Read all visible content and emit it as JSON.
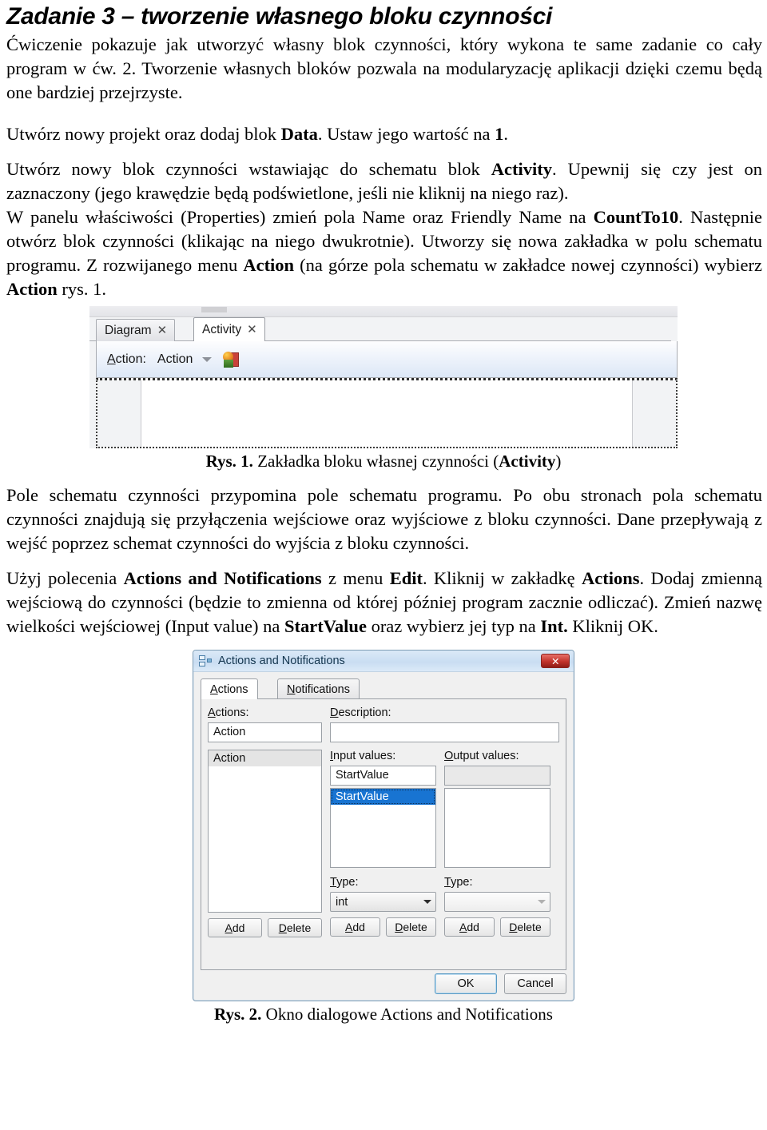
{
  "document": {
    "title": "Zadanie 3 – tworzenie własnego bloku czynności",
    "paragraphs": {
      "p1_a": "Ćwiczenie pokazuje jak utworzyć własny blok czynności, który wykona te same zadanie co cały program w ćw. 2. Tworzenie własnych bloków pozwala na modularyzację aplikacji dzięki czemu będą one bardziej przejrzyste.",
      "p2_pre": "Utwórz nowy projekt oraz dodaj blok ",
      "p2_b1": "Data",
      "p2_post": ". Ustaw jego wartość na ",
      "p2_b2": "1",
      "p2_end": ".",
      "p3_s1": "Utwórz nowy blok czynności wstawiając do schematu blok ",
      "p3_b1": "Activity",
      "p3_s2": ". Upewnij się czy jest on zaznaczony (jego krawędzie będą podświetlone, jeśli nie kliknij na niego raz).",
      "p4_s1": "W panelu właściwości (Properties) zmień pola Name oraz Friendly Name na ",
      "p4_b1": "CountTo10",
      "p4_s2": ". Następnie otwórz blok czynności (klikając na niego dwukrotnie). Utworzy się nowa zakładka w polu schematu programu. Z rozwijanego menu ",
      "p4_b2": "Action",
      "p4_s3": " (na górze pola schematu w zakładce nowej czynności) wybierz ",
      "p4_b3": "Action",
      "p4_s4": " rys. 1.",
      "p5": "Pole schematu czynności przypomina pole schematu programu. Po obu stronach pola schematu czynności znajdują się przyłączenia wejściowe oraz wyjściowe z bloku czynności. Dane przepływają z wejść poprzez schemat czynności do wyjścia z bloku czynności.",
      "p6_s1": "Użyj polecenia ",
      "p6_b1": "Actions and Notifications",
      "p6_s2": " z menu ",
      "p6_b2": "Edit",
      "p6_s3": ". Kliknij w zakładkę ",
      "p6_b3": "Actions",
      "p6_s4": ". Dodaj zmienną wejściową do czynności (będzie to zmienna od której później program zacznie odliczać). Zmień nazwę wielkości wejściowej (Input value) na  ",
      "p6_b4": "StartValue",
      "p6_s5": " oraz wybierz jej typ na ",
      "p6_b5": "Int.",
      "p6_s6": " Kliknij OK."
    },
    "captions": {
      "fig1_num": "Rys. 1.",
      "fig1_text_pre": " Zakładka bloku własnej czynności (",
      "fig1_bold": "Activity",
      "fig1_text_post": ")",
      "fig2_num": "Rys. 2.",
      "fig2_text": " Okno dialogowe Actions and Notifications"
    }
  },
  "figure1": {
    "tabs": [
      {
        "label": "Diagram",
        "close": "✕",
        "active": false
      },
      {
        "label": "Activity",
        "close": "✕",
        "active": true
      }
    ],
    "toolbar": {
      "action_label": "Action:",
      "action_label_mnemonic": "A",
      "action_label_rest": "ction:",
      "combo_value": "Action",
      "caret": "▾",
      "icon_name": "insert-action-icon"
    }
  },
  "figure2": {
    "window_title": "Actions and Notifications",
    "close_glyph": "✕",
    "tabs": [
      {
        "mnemonic": "A",
        "rest": "ctions",
        "selected": true
      },
      {
        "mnemonic": "N",
        "rest": "otifications",
        "selected": false
      }
    ],
    "labels": {
      "actions": {
        "mnemonic": "A",
        "rest": "ctions:"
      },
      "description": {
        "mnemonic": "D",
        "rest": "escription:"
      },
      "input_values": {
        "mnemonic": "I",
        "rest": "nput values:"
      },
      "output_values": {
        "mnemonic": "O",
        "rest": "utput values:"
      },
      "type_in": {
        "mnemonic": "T",
        "rest": "ype:"
      },
      "type_out": {
        "mnemonic": "T",
        "rest": "ype:"
      }
    },
    "values": {
      "actions_textbox": "Action",
      "actions_list_selected": "Action",
      "description_textbox": "",
      "input_textbox": "StartValue",
      "input_list_selected": "StartValue",
      "output_textbox": "",
      "type_in_value": "int",
      "type_out_value": ""
    },
    "buttons": {
      "add": {
        "mnemonic": "A",
        "rest": "dd"
      },
      "delete": {
        "mnemonic": "D",
        "rest": "elete"
      },
      "ok": "OK",
      "cancel": "Cancel"
    },
    "colors": {
      "selection_blue": "#1874d2",
      "titlebar_blue": "#c9ddf2",
      "close_red": "#c1322b"
    }
  }
}
